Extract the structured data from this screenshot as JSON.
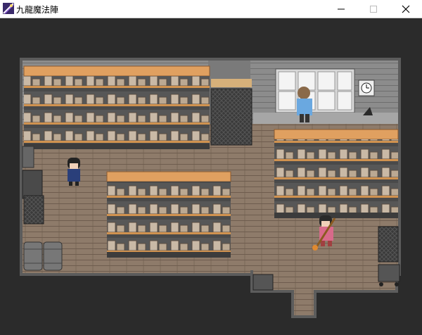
{
  "window": {
    "title": "九龍魔法陣",
    "minimize_icon": "minimize-icon",
    "maximize_icon": "maximize-icon",
    "close_icon": "close-icon"
  },
  "scene": {
    "type": "rpg-warehouse-interior",
    "characters": [
      "dark-haired-girl-blue-outfit",
      "shopkeeper-at-window",
      "girl-with-staff-orange"
    ],
    "colors": {
      "background": "#2b2b2b",
      "wall": "#8a8a8a",
      "floor": "#8e7b6a",
      "shelf_top": "#e0a060",
      "box": "#c8b8a8"
    }
  }
}
